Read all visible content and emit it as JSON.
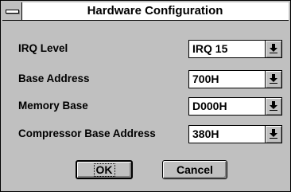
{
  "window": {
    "title": "Hardware Configuration"
  },
  "fields": [
    {
      "label": "IRQ Level",
      "value": "IRQ 15"
    },
    {
      "label": "Base Address",
      "value": "700H"
    },
    {
      "label": "Memory Base",
      "value": "D000H"
    },
    {
      "label": "Compressor Base Address",
      "value": "380H"
    }
  ],
  "buttons": {
    "ok_label": "OK",
    "cancel_label": "Cancel"
  },
  "icons": {
    "system_menu": "system-menu-icon",
    "dropdown_arrow": "dropdown-arrow-icon"
  }
}
